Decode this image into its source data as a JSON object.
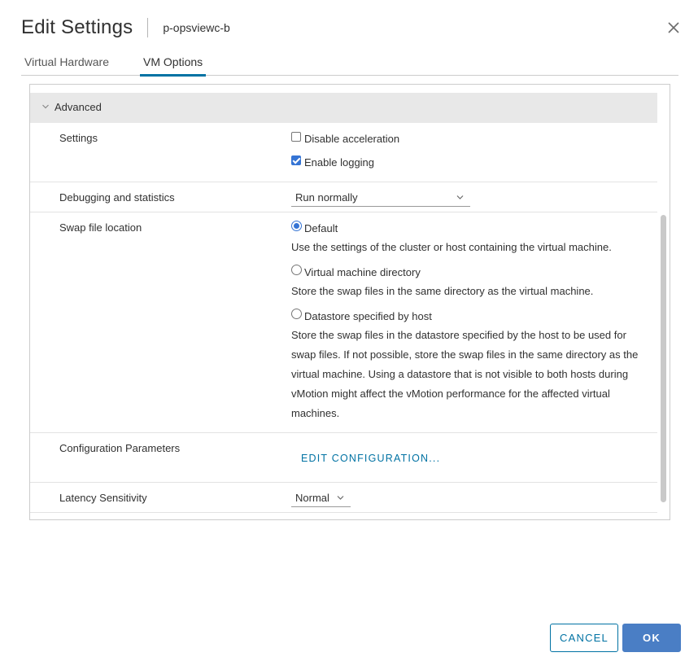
{
  "header": {
    "title": "Edit Settings",
    "vm_name": "p-opsviewc-b"
  },
  "tabs": [
    {
      "label": "Virtual Hardware",
      "active": false
    },
    {
      "label": "VM Options",
      "active": true
    }
  ],
  "section": {
    "title": "Advanced",
    "expanded": true
  },
  "settings": {
    "label": "Settings",
    "options": [
      {
        "label": "Disable acceleration",
        "checked": false
      },
      {
        "label": "Enable logging",
        "checked": true
      }
    ]
  },
  "debugging": {
    "label": "Debugging and statistics",
    "selected": "Run normally"
  },
  "swap": {
    "label": "Swap file location",
    "options": [
      {
        "label": "Default",
        "checked": true,
        "desc": "Use the settings of the cluster or host containing the virtual machine."
      },
      {
        "label": "Virtual machine directory",
        "checked": false,
        "desc": "Store the swap files in the same directory as the virtual machine."
      },
      {
        "label": "Datastore specified by host",
        "checked": false,
        "desc": "Store the swap files in the datastore specified by the host to be used for swap files. If not possible, store the swap files in the same directory as the virtual machine. Using a datastore that is not visible to both hosts during vMotion might affect the vMotion performance for the affected virtual machines."
      }
    ]
  },
  "config_params": {
    "label": "Configuration Parameters",
    "button": "EDIT CONFIGURATION..."
  },
  "latency": {
    "label": "Latency Sensitivity",
    "selected": "Normal"
  },
  "footer": {
    "cancel": "CANCEL",
    "ok": "OK"
  },
  "colors": {
    "accent": "#0072a3",
    "primary_button": "#4a7ec5",
    "checkbox_checked": "#3574d4",
    "section_header_bg": "#e8e8e8"
  }
}
